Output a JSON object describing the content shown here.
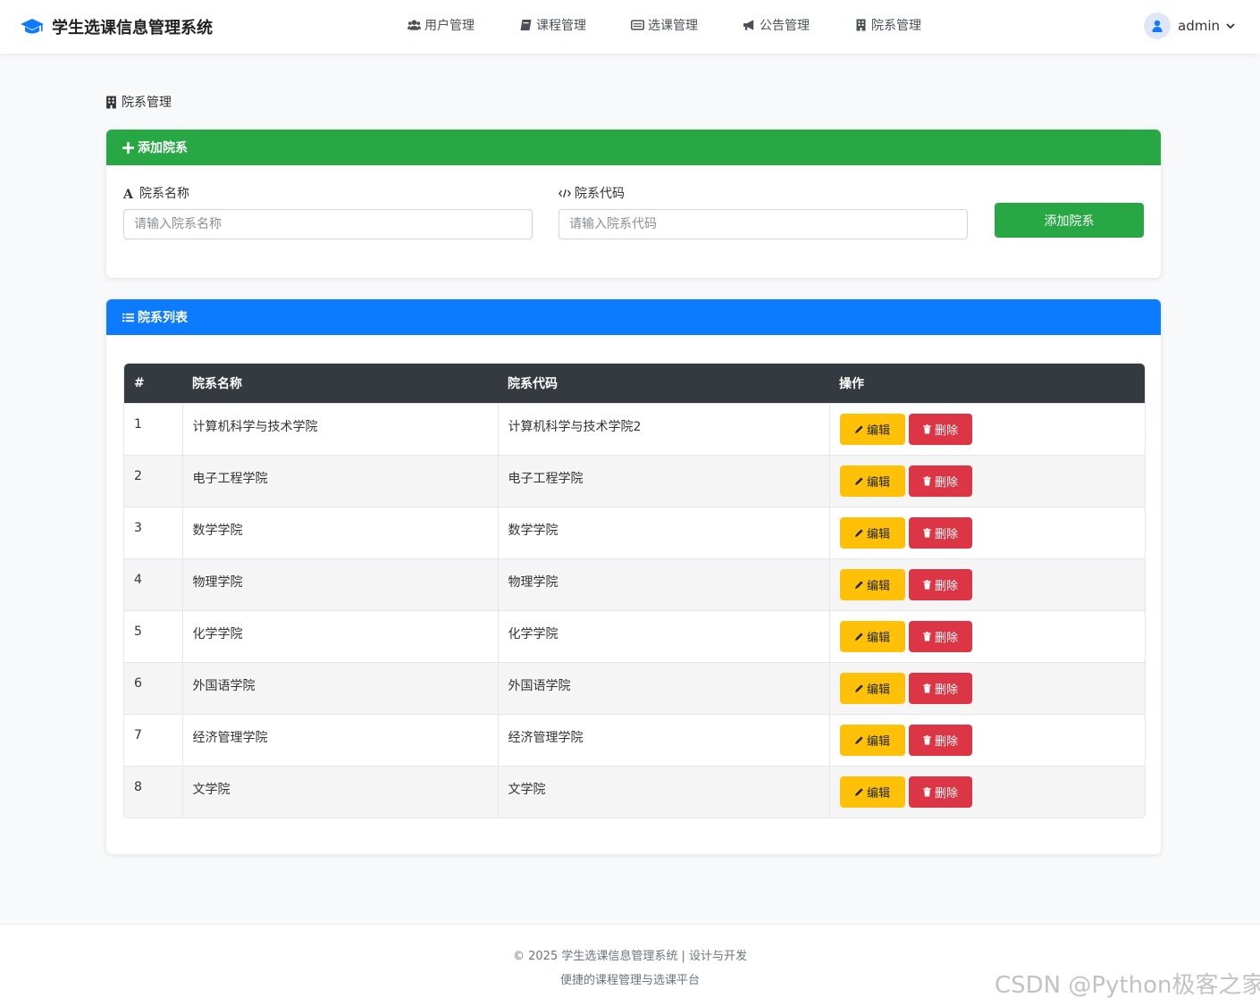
{
  "navbar": {
    "brand": "学生选课信息管理系统",
    "links": [
      {
        "label": "用户管理",
        "icon": "users-icon"
      },
      {
        "label": "课程管理",
        "icon": "book-icon"
      },
      {
        "label": "选课管理",
        "icon": "list-alt-icon"
      },
      {
        "label": "公告管理",
        "icon": "bullhorn-icon"
      },
      {
        "label": "院系管理",
        "icon": "building-icon"
      }
    ],
    "user": "admin"
  },
  "page": {
    "title": "院系管理"
  },
  "add_form": {
    "header": "添加院系",
    "name_label": "院系名称",
    "name_placeholder": "请输入院系名称",
    "name_value": "",
    "code_label": "院系代码",
    "code_placeholder": "请输入院系代码",
    "code_value": "",
    "submit_label": "添加院系"
  },
  "list": {
    "header": "院系列表",
    "columns": [
      "#",
      "院系名称",
      "院系代码",
      "操作"
    ],
    "edit_label": "编辑",
    "delete_label": "删除",
    "rows": [
      {
        "id": "1",
        "name": "计算机科学与技术学院",
        "code": "计算机科学与技术学院2"
      },
      {
        "id": "2",
        "name": "电子工程学院",
        "code": "电子工程学院"
      },
      {
        "id": "3",
        "name": "数学学院",
        "code": "数学学院"
      },
      {
        "id": "4",
        "name": "物理学院",
        "code": "物理学院"
      },
      {
        "id": "5",
        "name": "化学学院",
        "code": "化学学院"
      },
      {
        "id": "6",
        "name": "外国语学院",
        "code": "外国语学院"
      },
      {
        "id": "7",
        "name": "经济管理学院",
        "code": "经济管理学院"
      },
      {
        "id": "8",
        "name": "文学院",
        "code": "文学院"
      }
    ]
  },
  "footer": {
    "line1": "© 2025 学生选课信息管理系统 | 设计与开发",
    "line2": "便捷的课程管理与选课平台"
  },
  "watermark": "CSDN @Python极客之家",
  "colors": {
    "success": "#28a745",
    "primary": "#0d7bff",
    "warning": "#ffc107",
    "danger": "#dc3545",
    "table_header": "#343a40"
  }
}
